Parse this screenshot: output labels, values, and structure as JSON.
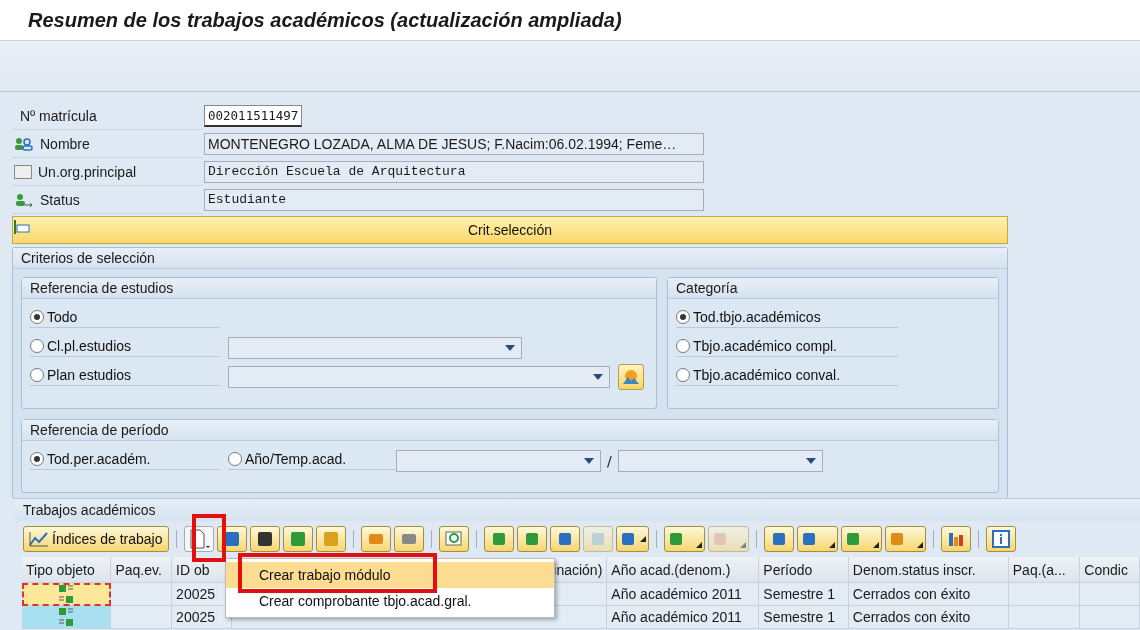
{
  "window": {
    "title": "Resumen de los trabajos académicos (actualización ampliada)"
  },
  "header_fields": [
    {
      "kind": "input",
      "label": "Nº matrícula",
      "value": "002011511497"
    },
    {
      "kind": "persons",
      "label": "Nombre",
      "value": "MONTENEGRO LOZADA, ALMA DE JESUS; F.Nacim:06.02.1994; Feme…"
    },
    {
      "kind": "org",
      "label": "Un.org.principal",
      "value": "Dirección Escuela de Arquitectura"
    },
    {
      "kind": "status",
      "label": "Status",
      "value": "Estudiante"
    }
  ],
  "selection_toggle": {
    "label": "Crit.selección"
  },
  "criteria": {
    "title": "Criterios de selección",
    "study_ref": {
      "title": "Referencia de estudios",
      "options": [
        {
          "label": "Todo",
          "selected": true,
          "kind": "plain"
        },
        {
          "label": "Cl.pl.estudios",
          "selected": false,
          "kind": "dropdown"
        },
        {
          "label": "Plan estudios",
          "selected": false,
          "kind": "dropdown_picker"
        }
      ]
    },
    "category": {
      "title": "Categoría",
      "options": [
        {
          "label": "Tod.tbjo.académicos",
          "selected": true
        },
        {
          "label": "Tbjo.académico compl.",
          "selected": false
        },
        {
          "label": "Tbjo.académico conval.",
          "selected": false
        }
      ]
    },
    "period_ref": {
      "title": "Referencia de período",
      "options": [
        {
          "label": "Tod.per.académ.",
          "selected": true
        },
        {
          "label": "Año/Temp.acad.",
          "selected": false
        }
      ],
      "separator": "/"
    }
  },
  "works": {
    "title": "Trabajos académicos",
    "index_button": "Índices de trabajo",
    "columns": [
      "Tipo objeto",
      "Paq.ev.",
      "ID ob",
      "inación)",
      "Año acad.(denom.)",
      "Período",
      "Denom.status inscr.",
      "Paq.(a...",
      "Condic"
    ],
    "rows": [
      {
        "selected": true,
        "id": "20025",
        "year": "Año académico 2011",
        "period": "Semestre 1",
        "status": "Cerrados con éxito"
      },
      {
        "selected": false,
        "id": "20025",
        "year": "Año académico 2011",
        "period": "Semestre 1",
        "status": "Cerrados con éxito"
      }
    ],
    "create_menu": [
      {
        "label": "Crear trabajo módulo",
        "selected": true
      },
      {
        "label": "Crear comprobante tbjo.acad.gral.",
        "selected": false
      }
    ]
  }
}
